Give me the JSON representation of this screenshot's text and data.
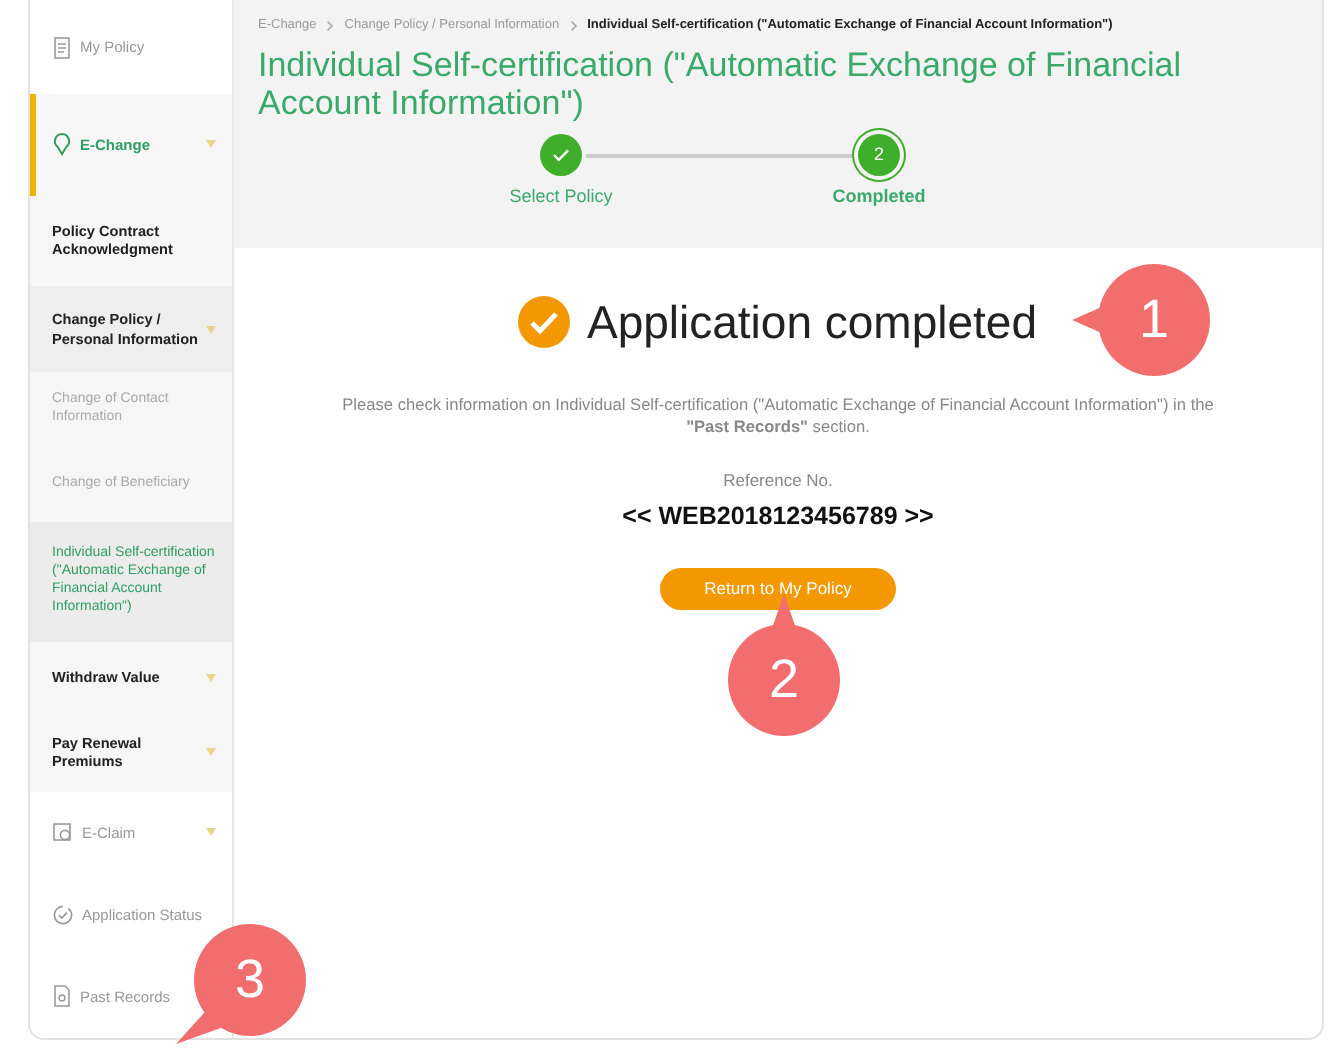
{
  "sidebar": {
    "items": [
      {
        "label": "My Policy",
        "selected": false,
        "caret": false
      },
      {
        "label": "E-Change",
        "selected": true,
        "caret": true,
        "children": [
          {
            "label": "Policy Contract Acknowledgment",
            "selected": false,
            "caret": false
          },
          {
            "label": "Change Policy / Personal Information",
            "selected": false,
            "caret": true,
            "children": [
              {
                "label": "Change of Contact Information",
                "selected": false
              },
              {
                "label": "Change of Beneficiary",
                "selected": false
              },
              {
                "label": "Individual Self-certification (\"Automatic Exchange of Financial Account Information\")",
                "selected": true
              }
            ]
          },
          {
            "label": "Withdraw Value",
            "selected": false,
            "caret": true
          },
          {
            "label": "Pay Renewal Premiums",
            "selected": false,
            "caret": true
          }
        ]
      },
      {
        "label": "E-Claim",
        "selected": false,
        "caret": true
      },
      {
        "label": "Application Status",
        "selected": false,
        "caret": false
      },
      {
        "label": "Past Records",
        "selected": false
      }
    ]
  },
  "breadcrumb": [
    {
      "label": "E-Change",
      "current": false
    },
    {
      "label": "Change Policy / Personal Information",
      "current": false
    },
    {
      "label": "Individual Self-certification (\"Automatic Exchange of Financial Account Information\")",
      "current": true
    }
  ],
  "title": "Individual Self-certification (\"Automatic Exchange of Financial Account Information\")",
  "steps": [
    {
      "label": "Select Policy",
      "kind": "done",
      "selected": false
    },
    {
      "label": "Completed",
      "kind": "current",
      "number": "2",
      "selected": true
    }
  ],
  "result": {
    "heading": "Application completed",
    "message": "Please check information on Individual Self-certification (\"Automatic Exchange of Financial Account Information\") in the **\"Past Records\"** section.",
    "reference_label": "Reference No.",
    "reference_number": "<< WEB2018123456789 >>",
    "button": "Return to My Policy"
  },
  "callouts": [
    {
      "label": "1",
      "kind": "left"
    },
    {
      "label": "2",
      "kind": "up"
    },
    {
      "label": "3",
      "kind": "downleft"
    }
  ]
}
